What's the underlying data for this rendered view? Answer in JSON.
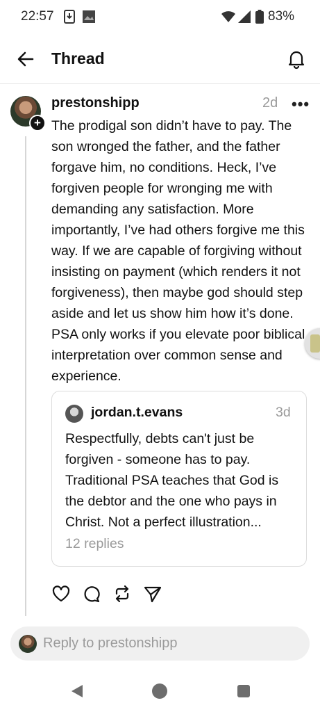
{
  "status_bar": {
    "time": "22:57",
    "battery": "83%",
    "icons": [
      "download-icon",
      "image-icon",
      "wifi-icon",
      "signal-icon",
      "battery-icon"
    ]
  },
  "header": {
    "title": "Thread",
    "back_icon": "arrow-left-icon",
    "bell_icon": "bell-icon"
  },
  "post": {
    "username": "prestonshipp",
    "time": "2d",
    "more_label": "•••",
    "text": "The prodigal son didn’t have to pay. The son wronged the father, and the father forgave him, no conditions. Heck, I’ve forgiven people for wronging me with demanding any satisfaction. More importantly, I’ve had others forgive me this way. If we are capable of forgiving without insisting on payment (which renders it not forgiveness), then maybe god should step aside and let us show him how it’s done. PSA only works if you elevate poor biblical interpretation over common sense and experience.",
    "follow_badge": "+"
  },
  "quote": {
    "username": "jordan.t.evans",
    "time": "3d",
    "text": "Respectfully, debts can't just be forgiven - someone has to pay. Traditional PSA teaches that God is the debtor and the one who pays in Christ. Not a perfect illustration...",
    "replies": "12 replies"
  },
  "actions": [
    "heart-icon",
    "comment-icon",
    "repost-icon",
    "share-icon"
  ],
  "reply_bar": {
    "placeholder": "Reply to prestonshipp"
  },
  "nav": [
    "nav-back-icon",
    "nav-home-icon",
    "nav-recent-icon"
  ],
  "colors": {
    "text": "#111111",
    "muted": "#9a9a9a",
    "border": "#dcdcdc",
    "reply_bg": "#f0f0f0"
  }
}
